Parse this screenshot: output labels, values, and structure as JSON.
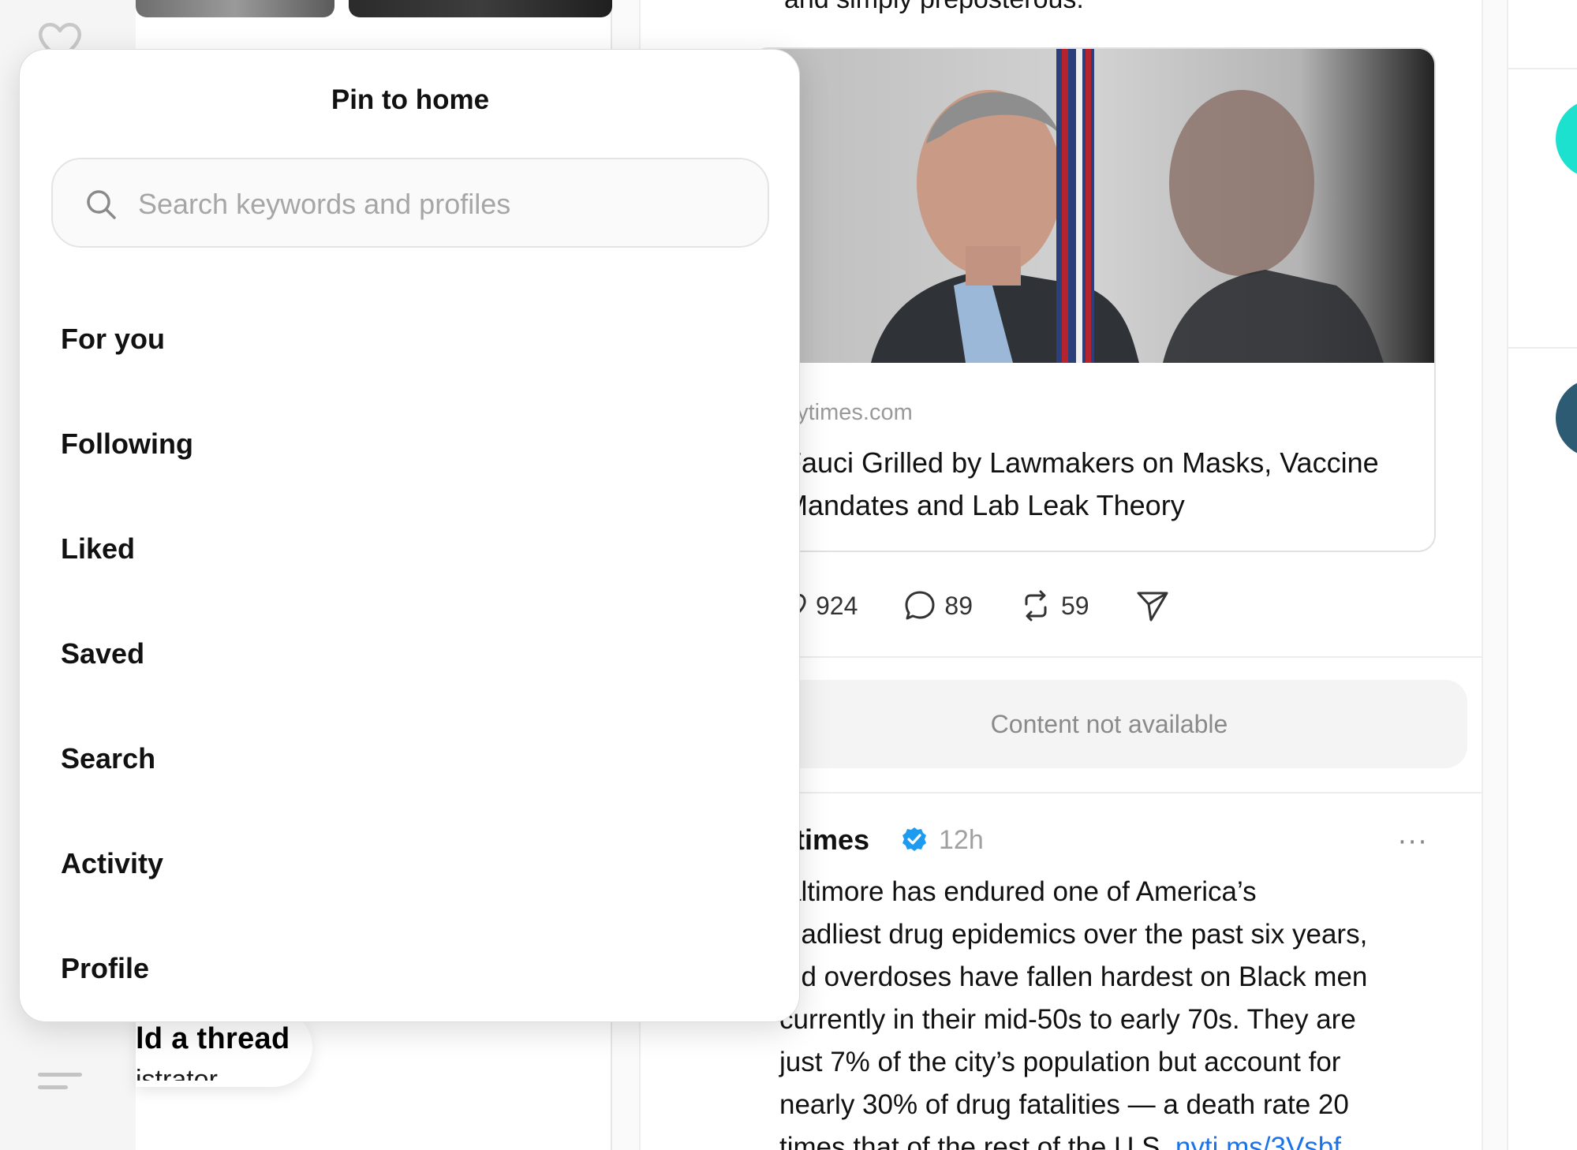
{
  "feed": {
    "top_text": "and simply preposterous.",
    "link_card": {
      "domain": "nytimes.com",
      "title": "Fauci Grilled by Lawmakers on Masks, Vaccine Mandates and Lab Leak Theory",
      "image_icon": "photo-fauci-profile"
    },
    "actions": {
      "likes": "924",
      "replies": "89",
      "reposts": "59"
    },
    "content_not_available": "Content not available",
    "post": {
      "author": "ytimes",
      "time": "12h",
      "more": "···",
      "body_lines": [
        "altimore has endured one of America’s",
        "eadliest drug epidemics over the past six years,",
        "nd overdoses have fallen hardest on Black men",
        "currently in their mid-50s to early 70s. They are",
        "just 7% of the city’s population but account for",
        "nearly 30% of drug fatalities — a death rate 20",
        "times that of the rest of the U.S."
      ],
      "link": "nyti.ms/3Vsbf"
    }
  },
  "left_col": {
    "new_thread_label": "ld a thread",
    "sub_label": "istrator"
  },
  "modal": {
    "title": "Pin to home",
    "search_placeholder": "Search keywords and profiles",
    "items": [
      "For you",
      "Following",
      "Liked",
      "Saved",
      "Search",
      "Activity",
      "Profile"
    ]
  },
  "colors": {
    "accent_link": "#1a73e8",
    "verified": "#1d9bf0",
    "avatar_1": "#1de1cf",
    "avatar_2": "#2d5b73"
  }
}
